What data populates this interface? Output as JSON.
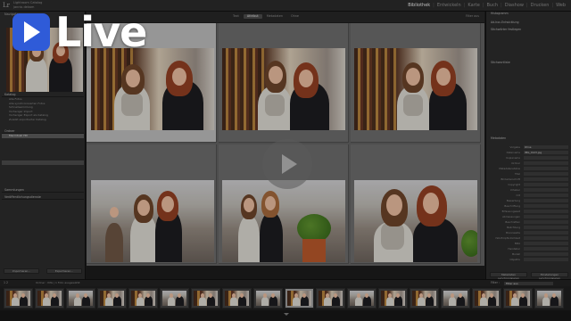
{
  "app": {
    "logo": "Lr",
    "catalog_line1": "Lightroom Catalog",
    "catalog_line2": "jannis dekam"
  },
  "modules": [
    "Bibliothek",
    "Entwickeln",
    "Karte",
    "Buch",
    "Diashow",
    "Drucken",
    "Web"
  ],
  "active_module": "Bibliothek",
  "left_panel": {
    "navigator_title": "Navigator",
    "catalog_title": "Katalog",
    "catalog_items": [
      {
        "label": "Alle Fotos",
        "count": ""
      },
      {
        "label": "Alle synchronisierten Fotos",
        "count": ""
      },
      {
        "label": "Schnellsammlung",
        "count": ""
      },
      {
        "label": "Vorheriger Import",
        "count": ""
      },
      {
        "label": "Vorheriger Export als Katalog",
        "count": ""
      },
      {
        "label": "Zuletzt exportierter Katalog",
        "count": ""
      }
    ],
    "folders_title": "Ordner",
    "folder_items": [
      {
        "label": "Macintosh HD",
        "count": ""
      },
      {
        "label": "",
        "count": ""
      },
      {
        "label": "",
        "count": ""
      },
      {
        "label": "",
        "count": ""
      },
      {
        "label": "",
        "count": ""
      },
      {
        "label": "",
        "count": ""
      },
      {
        "label": "",
        "count": ""
      }
    ],
    "collections_title": "Sammlungen",
    "publish_title": "Veröffentlichungsdienste",
    "import_btn": "Importieren...",
    "export_btn": "Exportieren..."
  },
  "toolbar": {
    "filter_tabs": [
      "Text",
      "Attribut",
      "Metadaten",
      "Ohne"
    ],
    "active_filter": "Attribut",
    "right_label": "Filter aus"
  },
  "right_panel": {
    "histogram_title": "Histogramm",
    "quick_develop_title": "Ad-hoc-Entwicklung",
    "keywords_title": "Stichwörter festlegen",
    "keyword_list_title": "Stichwortliste",
    "metadata_title": "Metadaten",
    "comments_title": "Kommentare",
    "sync_btn": "Metadaten synchronisieren",
    "sync_settings_btn": "Einstellungen synchronisieren",
    "meta_rows": [
      {
        "label": "Vorgabe",
        "value": "Ohne"
      },
      {
        "label": "Dateiname",
        "value": "IMG_0123.jpg"
      },
      {
        "label": "Kopiename",
        "value": ""
      },
      {
        "label": "Ordner",
        "value": ""
      },
      {
        "label": "Metadatenstatus",
        "value": ""
      },
      {
        "label": "Titel",
        "value": ""
      },
      {
        "label": "Bildunterschrift",
        "value": ""
      },
      {
        "label": "Copyright",
        "value": ""
      },
      {
        "label": "Urheber",
        "value": ""
      },
      {
        "label": "Ort",
        "value": ""
      },
      {
        "label": "Bewertung",
        "value": ""
      },
      {
        "label": "Beschriftung",
        "value": ""
      },
      {
        "label": "Erfassungszeit",
        "value": ""
      },
      {
        "label": "Abmessungen",
        "value": ""
      },
      {
        "label": "Beschnitten",
        "value": ""
      },
      {
        "label": "Belichtung",
        "value": ""
      },
      {
        "label": "Brennweite",
        "value": ""
      },
      {
        "label": "ISO-Empfindlichkeit",
        "value": ""
      },
      {
        "label": "Blitz",
        "value": ""
      },
      {
        "label": "Hersteller",
        "value": ""
      },
      {
        "label": "Modell",
        "value": ""
      },
      {
        "label": "Objektiv",
        "value": ""
      }
    ]
  },
  "filmstrip": {
    "nums": "1  2",
    "info": "Ordner : IMG | 1 Foto ausgewählt",
    "filter_label": "Filter :",
    "filter_value": "Filter aus"
  },
  "overlay": {
    "live_text": "Live"
  },
  "colors": {
    "badge": "#2f5bd8",
    "panel": "#2b2b2b",
    "grid": "#606060",
    "selected": "#b8b8b8"
  }
}
